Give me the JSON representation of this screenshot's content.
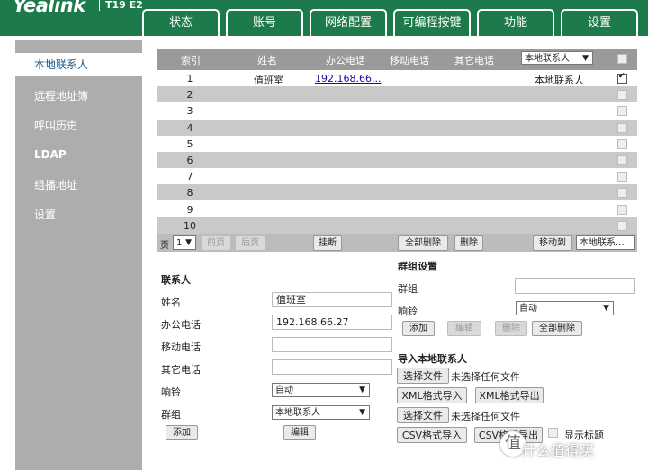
{
  "header": {
    "logo": "Yealink",
    "model": "T19 E2",
    "tabs": [
      "状态",
      "账号",
      "网络配置",
      "可编程按键",
      "功能",
      "设置"
    ]
  },
  "sidebar": {
    "items": [
      "本地联系人",
      "远程地址簿",
      "呼叫历史",
      "LDAP",
      "组播地址",
      "设置"
    ]
  },
  "table": {
    "headers": {
      "index": "索引",
      "name": "姓名",
      "office": "办公电话",
      "mobile": "移动电话",
      "other": "其它电话"
    },
    "group_filter": "本地联系人",
    "rows": [
      {
        "index": "1",
        "name": "值班室",
        "office": "192.168.66...",
        "group": "本地联系人",
        "checked": true
      },
      {
        "index": "2",
        "name": "",
        "office": "",
        "group": "",
        "checked": false
      },
      {
        "index": "3",
        "name": "",
        "office": "",
        "group": "",
        "checked": false
      },
      {
        "index": "4",
        "name": "",
        "office": "",
        "group": "",
        "checked": false
      },
      {
        "index": "5",
        "name": "",
        "office": "",
        "group": "",
        "checked": false
      },
      {
        "index": "6",
        "name": "",
        "office": "",
        "group": "",
        "checked": false
      },
      {
        "index": "7",
        "name": "",
        "office": "",
        "group": "",
        "checked": false
      },
      {
        "index": "8",
        "name": "",
        "office": "",
        "group": "",
        "checked": false
      },
      {
        "index": "9",
        "name": "",
        "office": "",
        "group": "",
        "checked": false
      },
      {
        "index": "10",
        "name": "",
        "office": "",
        "group": "",
        "checked": false
      }
    ]
  },
  "pager": {
    "page_label": "页",
    "page_value": "1",
    "prev": "前页",
    "next": "后页",
    "hangup": "挂断",
    "delete_all": "全部删除",
    "delete": "删除",
    "move_to": "移动到",
    "move_target": "本地联系..."
  },
  "contact_form": {
    "title": "联系人",
    "name_label": "姓名",
    "name_value": "值班室",
    "office_label": "办公电话",
    "office_value": "192.168.66.27",
    "mobile_label": "移动电话",
    "mobile_value": "",
    "other_label": "其它电话",
    "other_value": "",
    "ring_label": "响铃",
    "ring_value": "自动",
    "group_label": "群组",
    "group_value": "本地联系人",
    "add": "添加",
    "edit": "编辑"
  },
  "group_settings": {
    "title": "群组设置",
    "group_label": "群组",
    "group_value": "",
    "ring_label": "响铃",
    "ring_value": "自动",
    "add": "添加",
    "edit": "编辑",
    "delete": "删除",
    "delete_all": "全部删除"
  },
  "import": {
    "title": "导入本地联系人",
    "choose_file": "选择文件",
    "no_file": "未选择任何文件",
    "xml_import": "XML格式导入",
    "xml_export": "XML格式导出",
    "choose_file2": "选择文件",
    "no_file2": "未选择任何文件",
    "csv_import": "CSV格式导入",
    "csv_export": "CSV格式导出",
    "show_title": "显示标题"
  },
  "watermark": {
    "icon": "值",
    "text": "什么值得买"
  }
}
